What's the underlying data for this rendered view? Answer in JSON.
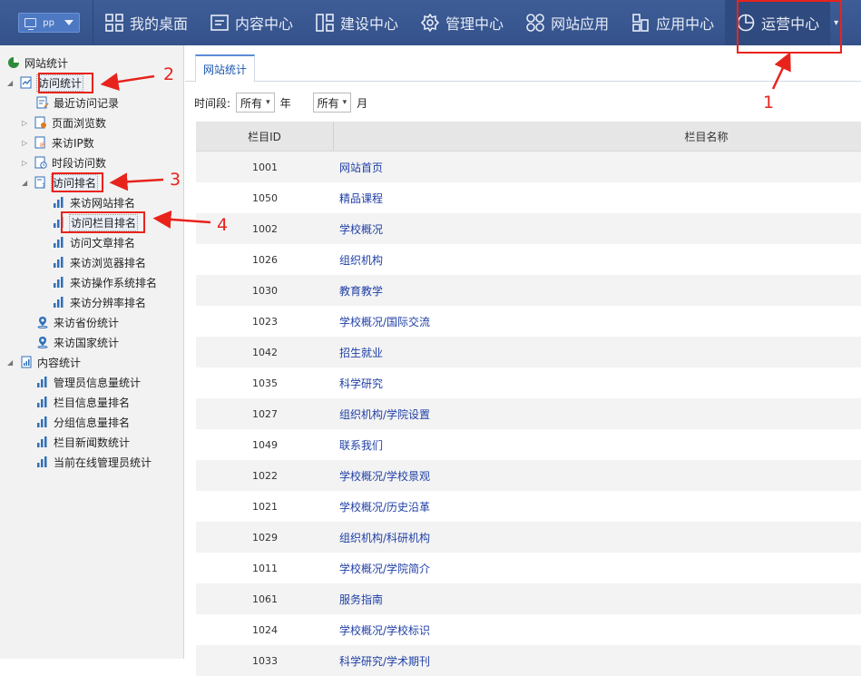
{
  "topbar": {
    "site_select": {
      "value": "pp",
      "icon": "monitor-icon"
    },
    "nav": [
      {
        "label": "我的桌面",
        "icon": "grid-icon"
      },
      {
        "label": "内容中心",
        "icon": "document-icon"
      },
      {
        "label": "建设中心",
        "icon": "layout-icon"
      },
      {
        "label": "管理中心",
        "icon": "gear-icon"
      },
      {
        "label": "网站应用",
        "icon": "apps-icon"
      },
      {
        "label": "应用中心",
        "icon": "puzzle-icon"
      },
      {
        "label": "运营中心",
        "icon": "pie-icon",
        "active": true
      }
    ]
  },
  "sidebar": {
    "root": "网站统计",
    "visits": "访问统计",
    "recent": "最近访问记录",
    "pageviews": "页面浏览数",
    "ip": "来访IP数",
    "period": "时段访问数",
    "rank": "访问排名",
    "rank_site": "来访网站排名",
    "rank_column": "访问栏目排名",
    "rank_article": "访问文章排名",
    "rank_browser": "来访浏览器排名",
    "rank_os": "来访操作系统排名",
    "rank_res": "来访分辨率排名",
    "province": "来访省份统计",
    "country": "来访国家统计",
    "content": "内容统计",
    "admin_info": "管理员信息量统计",
    "column_info": "栏目信息量排名",
    "group_info": "分组信息量排名",
    "column_news": "栏目新闻数统计",
    "online_admin": "当前在线管理员统计"
  },
  "main": {
    "tab": "网站统计",
    "filter": {
      "label": "时间段:",
      "year_value": "所有",
      "year_unit": "年",
      "month_value": "所有",
      "month_unit": "月"
    },
    "table": {
      "headers": [
        "栏目ID",
        "栏目名称"
      ],
      "rows": [
        {
          "id": "1001",
          "name": "网站首页"
        },
        {
          "id": "1050",
          "name": "精品课程"
        },
        {
          "id": "1002",
          "name": "学校概况"
        },
        {
          "id": "1026",
          "name": "组织机构"
        },
        {
          "id": "1030",
          "name": "教育教学"
        },
        {
          "id": "1023",
          "name": "学校概况/国际交流"
        },
        {
          "id": "1042",
          "name": "招生就业"
        },
        {
          "id": "1035",
          "name": "科学研究"
        },
        {
          "id": "1027",
          "name": "组织机构/学院设置"
        },
        {
          "id": "1049",
          "name": "联系我们"
        },
        {
          "id": "1022",
          "name": "学校概况/学校景观"
        },
        {
          "id": "1021",
          "name": "学校概况/历史沿革"
        },
        {
          "id": "1029",
          "name": "组织机构/科研机构"
        },
        {
          "id": "1011",
          "name": "学校概况/学院简介"
        },
        {
          "id": "1061",
          "name": "服务指南"
        },
        {
          "id": "1024",
          "name": "学校概况/学校标识"
        },
        {
          "id": "1033",
          "name": "科学研究/学术期刊"
        }
      ]
    }
  },
  "annotations": [
    "1",
    "2",
    "3",
    "4"
  ],
  "colors": {
    "topbar": "#3a5892",
    "annotation": "#e8231c",
    "link": "#1f3fa6"
  }
}
